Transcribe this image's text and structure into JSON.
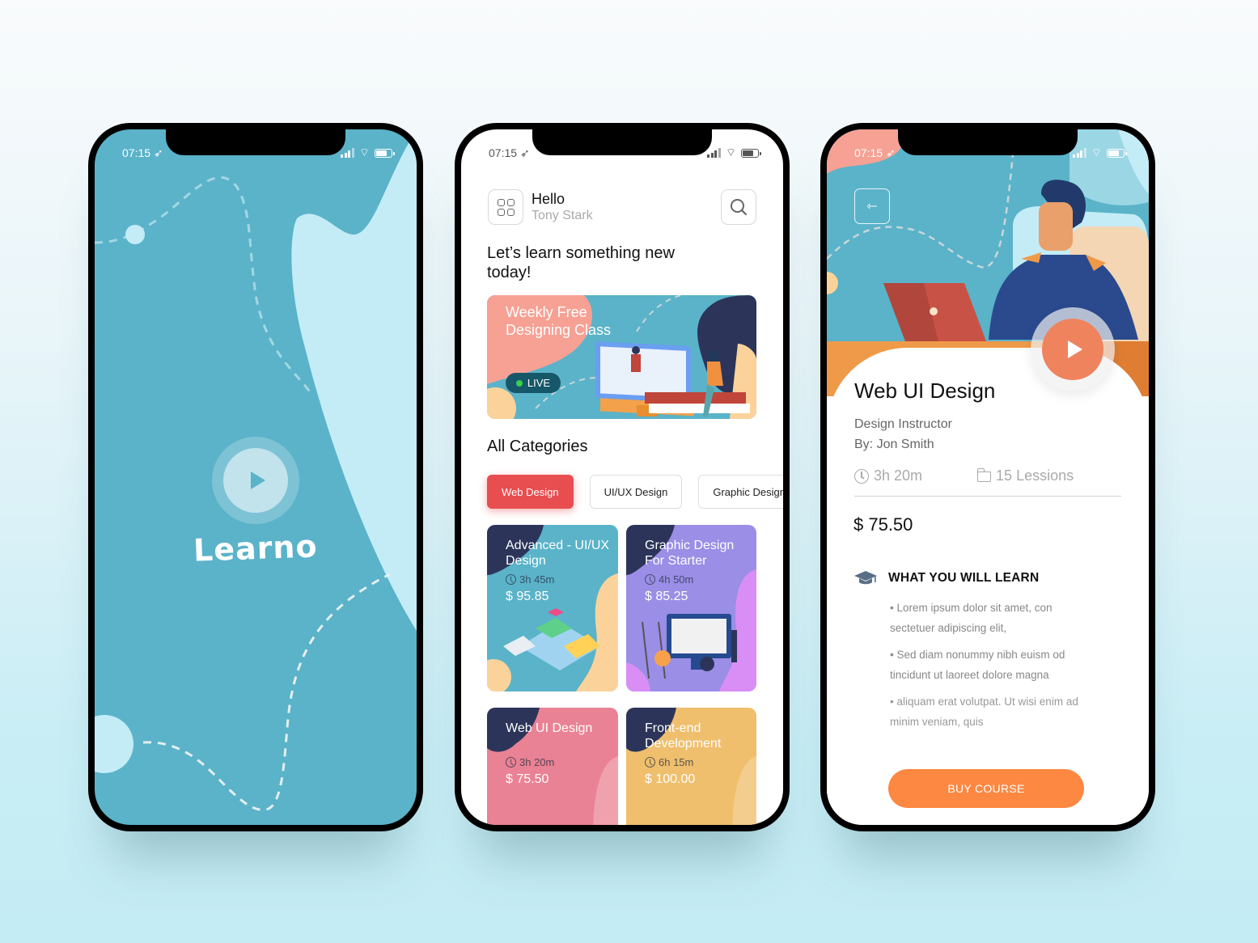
{
  "status_bar": {
    "time": "07:15"
  },
  "splash": {
    "app_name": "Learno",
    "play_icon": "play-icon",
    "colors": {
      "background": "#5ab3c9",
      "accent_shape": "#c4ecf6"
    }
  },
  "home": {
    "greeting": "Hello",
    "user_name": "Tony Stark",
    "menu_icon": "grid-icon",
    "search_icon": "search-icon",
    "tagline": "Let’s learn something new today!",
    "banner": {
      "title": "Weekly Free Designing Class",
      "live_label": "LIVE"
    },
    "categories_title": "All Categories",
    "categories": [
      {
        "label": "Web Design",
        "active": true
      },
      {
        "label": "UI/UX Design",
        "active": false
      },
      {
        "label": "Graphic Design",
        "active": false
      }
    ],
    "courses": [
      {
        "title": "Advanced - UI/UX Design",
        "duration": "3h 45m",
        "price": "$ 95.85",
        "color": "#5ab3c9"
      },
      {
        "title": "Graphic Design For Starter",
        "duration": "4h 50m",
        "price": "$ 85.25",
        "color": "#9a8ee6"
      },
      {
        "title": "Web UI Design",
        "duration": "3h 20m",
        "price": "$ 75.50",
        "color": "#e98294"
      },
      {
        "title": "Front-end Development",
        "duration": "6h 15m",
        "price": "$ 100.00",
        "color": "#efbf6d"
      }
    ],
    "colors": {
      "active_chip": "#e84d50"
    }
  },
  "detail": {
    "back_icon": "arrow-left-icon",
    "title": "Web UI Design",
    "instructor_role": "Design Instructor",
    "instructor": "By: Jon Smith",
    "duration": "3h 20m",
    "lessons": "15 Lessions",
    "price": "$ 75.50",
    "learn_heading": "WHAT YOU WILL LEARN",
    "learn_items": [
      "•  Lorem ipsum dolor sit amet, con sectetuer adipiscing elit,",
      "•  Sed diam nonummy nibh euism od tincidunt ut laoreet dolore magna",
      "• aliquam erat volutpat. Ut wisi enim ad minim veniam, quis"
    ],
    "buy_label": "BUY COURSE",
    "colors": {
      "play": "#ef835e",
      "buy": "#fd8842"
    }
  }
}
